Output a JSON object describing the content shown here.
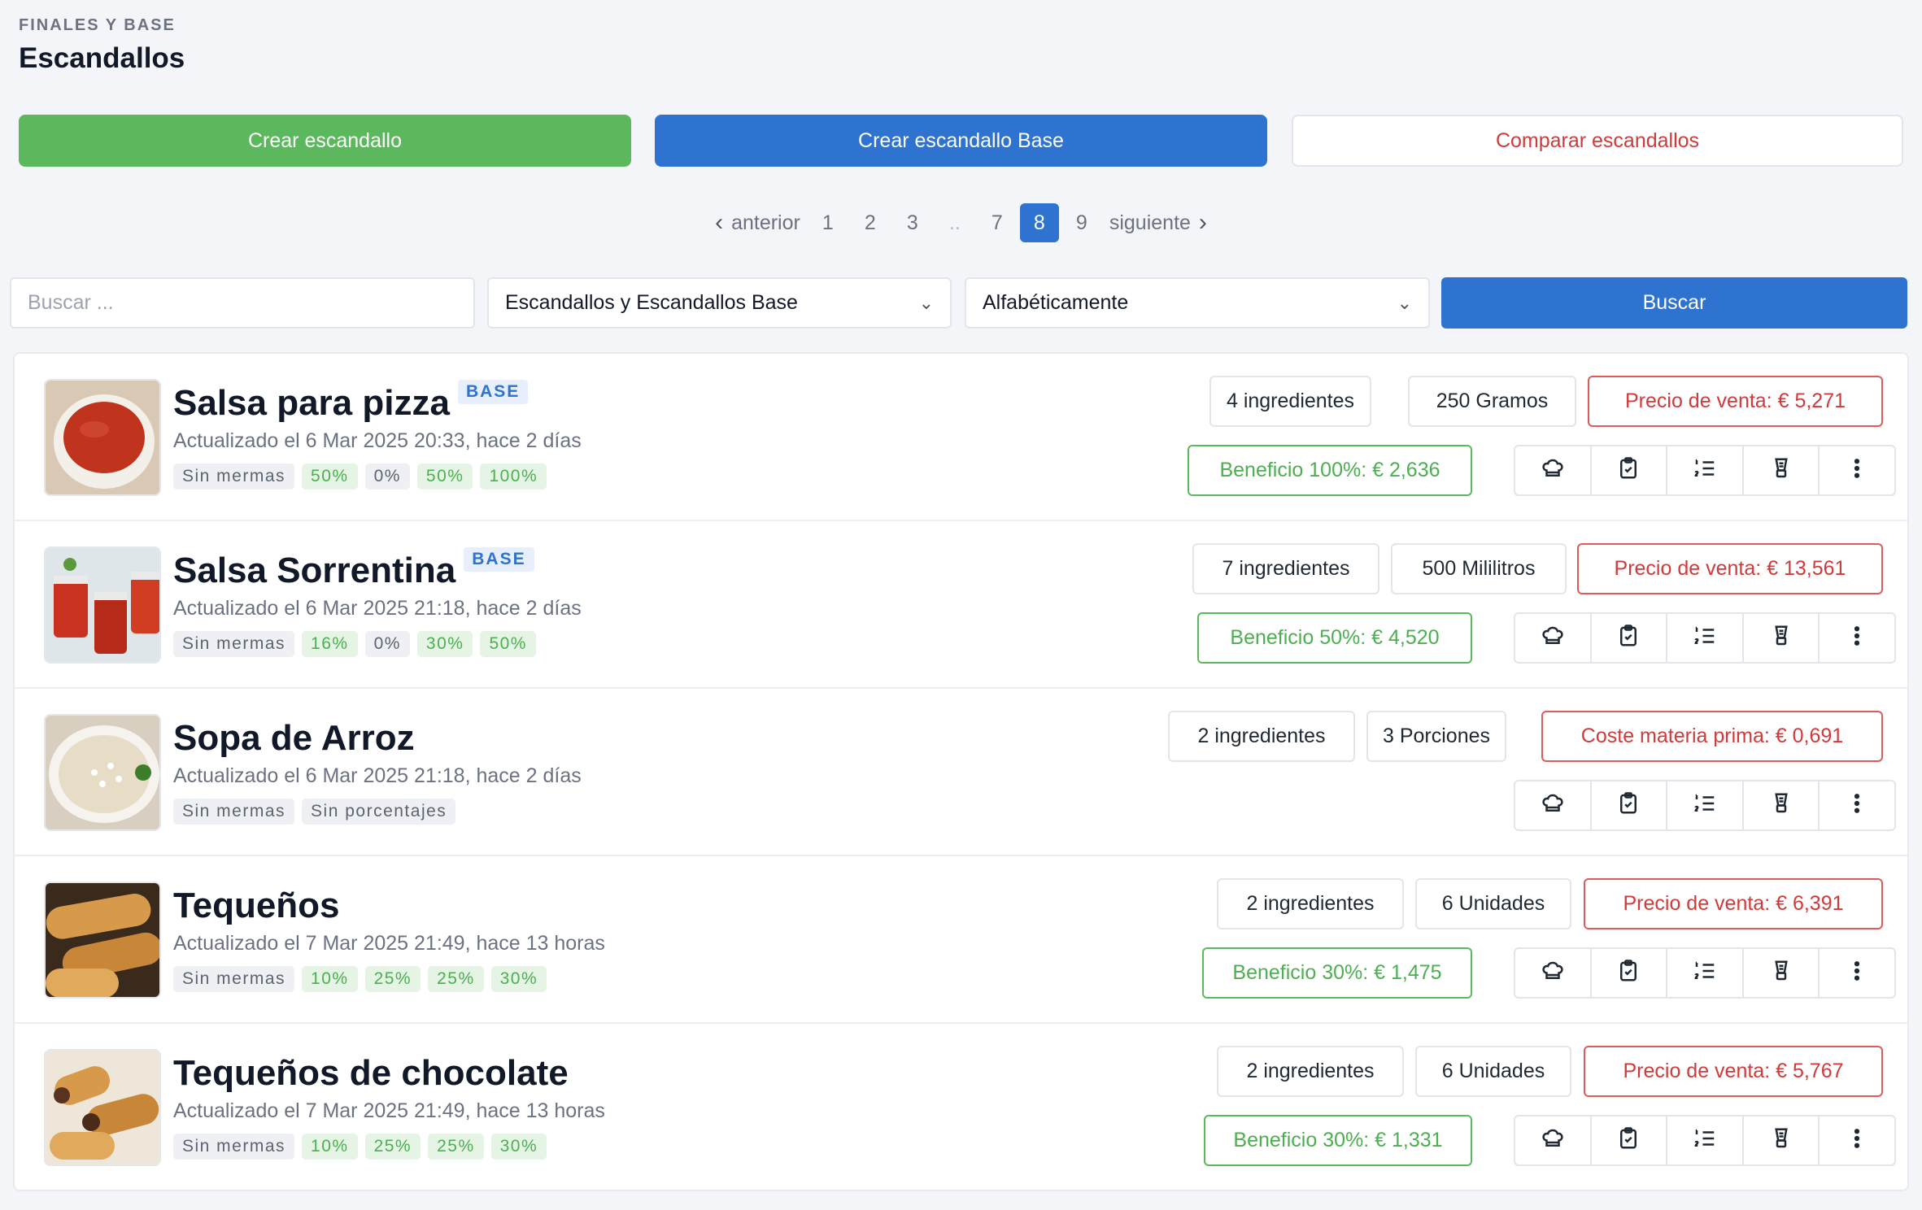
{
  "header": {
    "eyebrow": "FINALES Y BASE",
    "title": "Escandallos"
  },
  "actions": {
    "create": "Crear escandallo",
    "create_base": "Crear escandallo Base",
    "compare": "Comparar escandallos"
  },
  "pagination": {
    "prev": "anterior",
    "next": "siguiente",
    "pages": [
      "1",
      "2",
      "3",
      "..",
      "7",
      "8",
      "9"
    ],
    "current": "8"
  },
  "filters": {
    "search_placeholder": "Buscar ...",
    "type_selected": "Escandallos y Escandallos Base",
    "sort_selected": "Alfabéticamente",
    "search_button": "Buscar"
  },
  "colors": {
    "green": "#5cb85c",
    "blue": "#2f73d0",
    "red": "#d13a3a"
  },
  "items": [
    {
      "name": "Salsa para pizza",
      "badge": "BASE",
      "updated": "Actualizado el 6 Mar 2025 20:33, hace 2 días",
      "tags": [
        "Sin mermas",
        "50%",
        "0%",
        "50%",
        "100%"
      ],
      "ingredients": "4 ingredientes",
      "quantity": "250 Gramos",
      "price": "Precio de venta: € 5,271",
      "profit": "Beneficio 100%: € 2,636"
    },
    {
      "name": "Salsa Sorrentina",
      "badge": "BASE",
      "updated": "Actualizado el 6 Mar 2025 21:18, hace 2 días",
      "tags": [
        "Sin mermas",
        "16%",
        "0%",
        "30%",
        "50%"
      ],
      "ingredients": "7 ingredientes",
      "quantity": "500 Mililitros",
      "price": "Precio de venta: € 13,561",
      "profit": "Beneficio 50%: € 4,520"
    },
    {
      "name": "Sopa de Arroz",
      "badge": "",
      "updated": "Actualizado el 6 Mar 2025 21:18, hace 2 días",
      "tags": [
        "Sin mermas",
        "Sin porcentajes"
      ],
      "ingredients": "2 ingredientes",
      "quantity": "3 Porciones",
      "price": "Coste materia prima: € 0,691",
      "profit": ""
    },
    {
      "name": "Tequeños",
      "badge": "",
      "updated": "Actualizado el 7 Mar 2025 21:49, hace 13 horas",
      "tags": [
        "Sin mermas",
        "10%",
        "25%",
        "25%",
        "30%"
      ],
      "ingredients": "2 ingredientes",
      "quantity": "6 Unidades",
      "price": "Precio de venta: € 6,391",
      "profit": "Beneficio 30%: € 1,475"
    },
    {
      "name": "Tequeños de chocolate",
      "badge": "",
      "updated": "Actualizado el 7 Mar 2025 21:49, hace 13 horas",
      "tags": [
        "Sin mermas",
        "10%",
        "25%",
        "25%",
        "30%"
      ],
      "ingredients": "2 ingredientes",
      "quantity": "6 Unidades",
      "price": "Precio de venta: € 5,767",
      "profit": "Beneficio 30%: € 1,331"
    }
  ]
}
